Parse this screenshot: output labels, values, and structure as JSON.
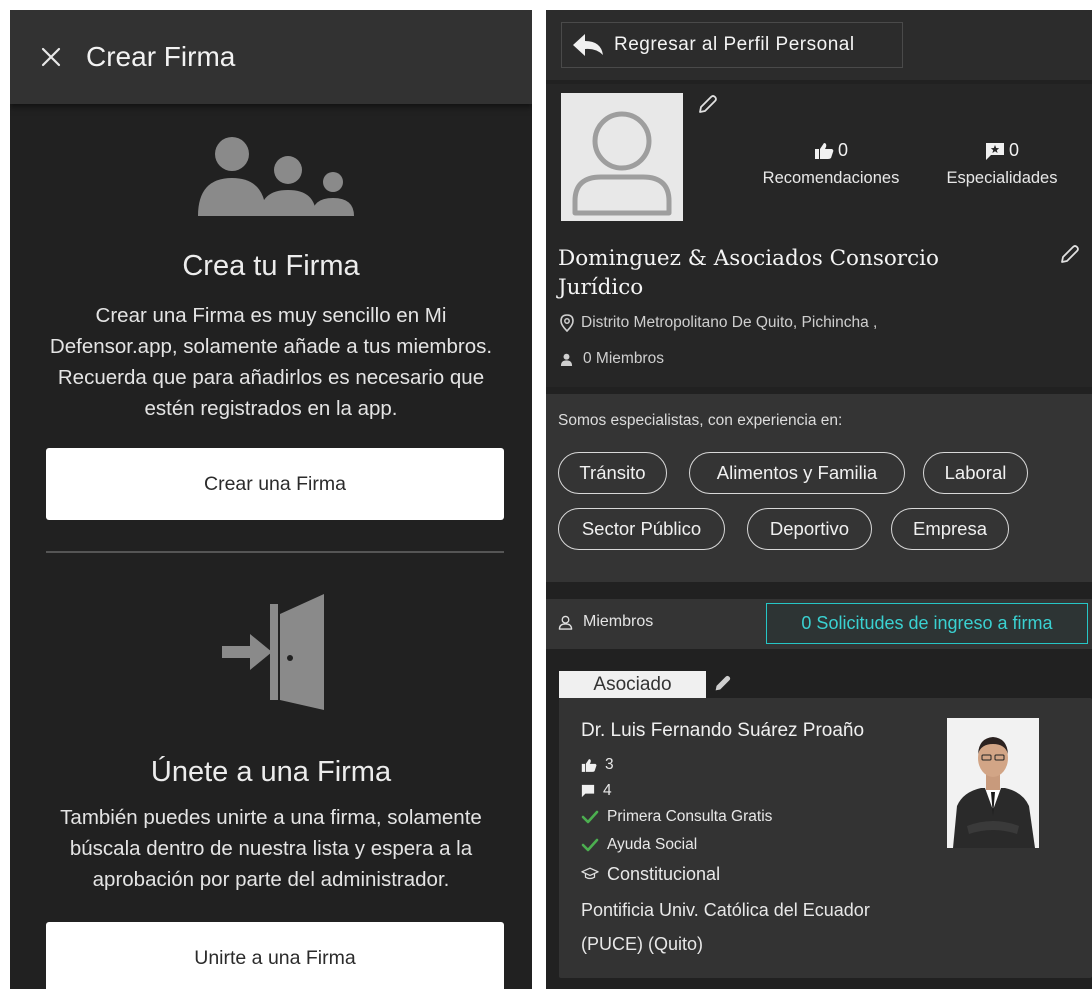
{
  "left_panel": {
    "header_title": "Crear Firma",
    "create": {
      "title": "Crea tu Firma",
      "description": "Crear una Firma es muy sencillo en Mi Defensor.app, solamente añade a tus miembros. Recuerda que para añadirlos es necesario que estén registrados en la app.",
      "button_label": "Crear una Firma"
    },
    "join": {
      "title": "Únete a una Firma",
      "description": "También puedes unirte a una firma, solamente búscala dentro de nuestra lista y espera a la aprobación por parte del administrador.",
      "button_label": "Unirte a una Firma"
    },
    "icons": [
      "close-icon",
      "people-group-icon",
      "enter-door-icon"
    ]
  },
  "right_panel": {
    "back_button_label": "Regresar al Perfil Personal",
    "profile": {
      "recommendations_count": "0",
      "recommendations_label": "Recomendaciones",
      "specialties_count": "0",
      "specialties_label": "Especialidades",
      "firm_name": "Dominguez & Asociados Consorcio Jurídico",
      "location": "Distrito Metropolitano De Quito, Pichincha ,",
      "members_count_text": "0 Miembros"
    },
    "specialties": {
      "intro": "Somos especialistas, con experiencia en:",
      "chips": [
        "Tránsito",
        "Alimentos y Familia",
        "Laboral",
        "Sector Público",
        "Deportivo",
        "Empresa"
      ]
    },
    "members_section": {
      "label": "Miembros",
      "requests_button": "0 Solicitudes de ingreso a firma"
    },
    "member_card": {
      "role": "Asociado",
      "name": "Dr. Luis Fernando Suárez Proaño",
      "likes": "3",
      "comments": "4",
      "features": [
        "Primera Consulta Gratis",
        "Ayuda Social"
      ],
      "specialty": "Constitucional",
      "university_line1": "Pontificia Univ. Católica del Ecuador",
      "university_line2": "(PUCE) (Quito)"
    }
  },
  "colors": {
    "background_dark": "#212121",
    "header_dark": "#323232",
    "accent_teal": "#26c6c6",
    "check_green": "#4caf50",
    "button_white": "#ffffff"
  }
}
